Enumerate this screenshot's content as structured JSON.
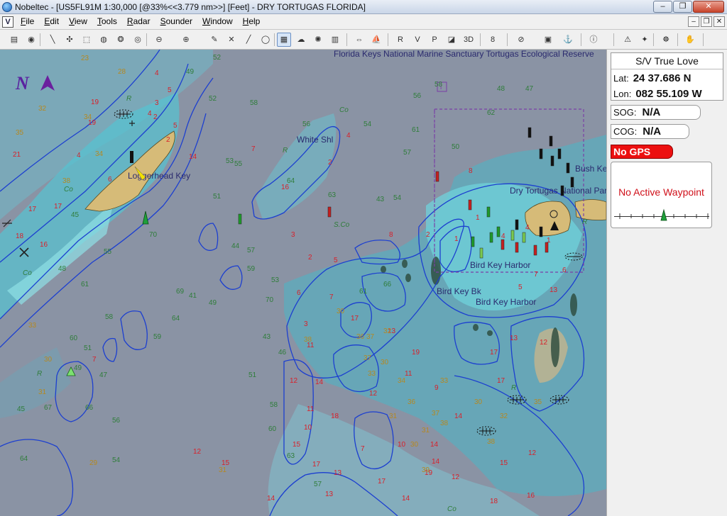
{
  "window": {
    "title": "Nobeltec - [US5FL91M 1:30,000 [@33%<<3.779 nm>>] [Feet] - DRY TORTUGAS FLORIDA]",
    "buttons": {
      "minimize": "–",
      "restore": "❐",
      "close": "✕"
    }
  },
  "menu": {
    "doc_icon": "V",
    "items": [
      {
        "key": "F",
        "rest": "ile"
      },
      {
        "key": "E",
        "rest": "dit"
      },
      {
        "key": "V",
        "rest": "iew"
      },
      {
        "key": "T",
        "rest": "ools"
      },
      {
        "key": "R",
        "rest": "adar"
      },
      {
        "key": "S",
        "rest": "ounder"
      },
      {
        "key": "W",
        "rest": "indow"
      },
      {
        "key": "H",
        "rest": "elp"
      }
    ],
    "mdi_buttons": {
      "minimize": "–",
      "restore": "❐",
      "close": "✕"
    }
  },
  "toolbar": {
    "buttons": [
      {
        "name": "route-icon",
        "glyph": "▤",
        "active": false
      },
      {
        "name": "globe-icon",
        "glyph": "◉",
        "active": false
      },
      {
        "name": "line-tool-icon",
        "glyph": "╲",
        "active": false
      },
      {
        "name": "waypoint-tool-icon",
        "glyph": "✣",
        "active": false
      },
      {
        "name": "zoom-box-icon",
        "glyph": "⬚",
        "active": false
      },
      {
        "name": "mark-icon",
        "glyph": "◍",
        "active": false
      },
      {
        "name": "event-icon",
        "glyph": "❂",
        "active": false
      },
      {
        "name": "lifebuoy-icon",
        "glyph": "◎",
        "active": false
      },
      {
        "name": "zoom-out-icon",
        "glyph": "⊖",
        "active": false
      },
      {
        "name": "zoom-in-icon",
        "glyph": "⊕",
        "active": false
      },
      {
        "name": "pencil-icon",
        "glyph": "✎",
        "active": false
      },
      {
        "name": "cross-tool-icon",
        "glyph": "✕",
        "active": false
      },
      {
        "name": "ruler-icon",
        "glyph": "╱",
        "active": false
      },
      {
        "name": "circle-tool-icon",
        "glyph": "◯",
        "active": false
      },
      {
        "name": "chart-select-icon",
        "glyph": "▦",
        "active": true
      },
      {
        "name": "cloud-icon",
        "glyph": "☁",
        "active": false
      },
      {
        "name": "weather-icon",
        "glyph": "✺",
        "active": false
      },
      {
        "name": "grid-icon",
        "glyph": "▥",
        "active": false
      },
      {
        "name": "split-icon",
        "glyph": "⇔",
        "active": false
      },
      {
        "name": "boat-icon",
        "glyph": "⛵",
        "active": false
      },
      {
        "name": "r-icon",
        "glyph": "R",
        "active": false
      },
      {
        "name": "v-icon",
        "glyph": "V",
        "active": false
      },
      {
        "name": "p-icon",
        "glyph": "P",
        "active": false
      },
      {
        "name": "perspective-icon",
        "glyph": "◪",
        "active": false
      },
      {
        "name": "3d-icon",
        "glyph": "3D",
        "active": false
      },
      {
        "name": "heading-icon",
        "glyph": "8",
        "active": false
      },
      {
        "name": "alarm-off-icon",
        "glyph": "⊘",
        "active": false
      },
      {
        "name": "layers-icon",
        "glyph": "▣",
        "active": false
      },
      {
        "name": "ship-icon",
        "glyph": "⚓",
        "active": false
      },
      {
        "name": "info-icon",
        "glyph": "ⓘ",
        "active": false
      },
      {
        "name": "warning-icon",
        "glyph": "⚠",
        "active": false
      },
      {
        "name": "ais-icon",
        "glyph": "✦",
        "active": false
      },
      {
        "name": "wheel-icon",
        "glyph": "☸",
        "active": false
      },
      {
        "name": "hand-icon",
        "glyph": "✋",
        "active": false
      }
    ]
  },
  "chart": {
    "place_labels": {
      "reserve": "Florida Keys National Marine Sanctuary Tortugas Ecological Reserve",
      "loggerhead": "Loggerhead Key",
      "white_shl": "White Shl",
      "bird_key_harbor": "Bird Key Harbor",
      "bird_key_bk": "Bird Key Bk",
      "national_park": "Dry Tortugas National Park",
      "bush": "Bush Key"
    },
    "north_label": "N",
    "area_marker": "i",
    "soundings_red": [
      "19",
      "4",
      "5",
      "3",
      "4",
      "5",
      "2",
      "2",
      "4",
      "6",
      "14",
      "19",
      "21",
      "17",
      "18",
      "16",
      "17",
      "7",
      "16",
      "2",
      "4",
      "3",
      "2",
      "5",
      "6",
      "3",
      "7",
      "11",
      "8",
      "12",
      "10",
      "7",
      "17",
      "13",
      "10",
      "14",
      "11",
      "9",
      "17",
      "13",
      "19",
      "14",
      "17",
      "13",
      "12",
      "15",
      "16",
      "18",
      "14",
      "12",
      "14",
      "12",
      "14",
      "15",
      "17",
      "13",
      "19",
      "17",
      "12",
      "11",
      "18",
      "14",
      "15",
      "12",
      "7",
      "2",
      "1",
      "8",
      "1",
      "4",
      "4",
      "1",
      "5",
      "13",
      "7",
      "6"
    ],
    "soundings_gold": [
      "23",
      "28",
      "32",
      "34",
      "35",
      "38",
      "34",
      "33",
      "30",
      "31",
      "29",
      "31",
      "30",
      "38",
      "36",
      "37",
      "32",
      "37",
      "30",
      "33",
      "34",
      "36",
      "31",
      "31",
      "38",
      "30",
      "35",
      "32",
      "37",
      "38",
      "33",
      "30",
      "39"
    ],
    "soundings_green": [
      "52",
      "49",
      "52",
      "58",
      "56",
      "54",
      "57",
      "61",
      "58",
      "48",
      "47",
      "56",
      "62",
      "53",
      "55",
      "64",
      "63",
      "43",
      "50",
      "51",
      "44",
      "57",
      "70",
      "45",
      "69",
      "41",
      "64",
      "59",
      "55",
      "48",
      "61",
      "58",
      "60",
      "51",
      "49",
      "47",
      "56",
      "54",
      "66",
      "67",
      "45",
      "64",
      "59",
      "49",
      "53",
      "70",
      "43",
      "46",
      "51",
      "58",
      "60",
      "63",
      "57",
      "66",
      "61",
      "54"
    ],
    "bottom_labels": {
      "r": "R",
      "co": "Co",
      "sco": "S.Co"
    }
  },
  "panel": {
    "vessel_name": "S/V True Love",
    "lat_label": "Lat:",
    "lat_value": "24 37.686 N",
    "lon_label": "Lon:",
    "lon_value": "082 55.109 W",
    "sog_label": "SOG:",
    "sog_value": "N/A",
    "cog_label": "COG:",
    "cog_value": "N/A",
    "gps_status": "No GPS",
    "waypoint_status": "No Active Waypoint"
  },
  "colors": {
    "deep_water": "#8a93a4",
    "shallow_water": "#4fc3d4",
    "contour": "#1c3fd0",
    "land": "#d6bb78",
    "gps_alert": "#ec1010",
    "reserve_boundary": "#7b3ea6"
  }
}
